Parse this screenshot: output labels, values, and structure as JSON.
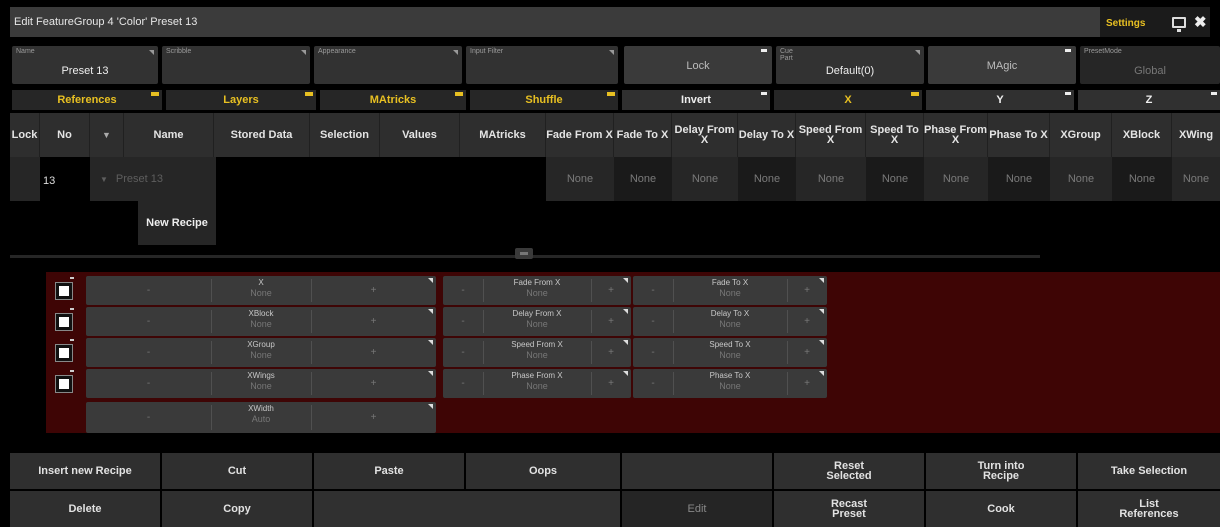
{
  "window": {
    "title": "Edit FeatureGroup 4 'Color' Preset 13",
    "settings_label": "Settings"
  },
  "fields": [
    {
      "label": "Name",
      "value": "Preset 13"
    },
    {
      "label": "Scribble",
      "value": ""
    },
    {
      "label": "Appearance",
      "value": ""
    },
    {
      "label": "Input Filter",
      "value": ""
    },
    {
      "label": "Cue Part",
      "value": "Default(0)"
    },
    {
      "label": "PresetMode",
      "value": "Global"
    }
  ],
  "buttons_top": {
    "lock": "Lock",
    "magic": "MAgic"
  },
  "tabs": [
    "References",
    "Layers",
    "MAtricks",
    "Shuffle",
    "Invert",
    "X",
    "Y",
    "Z"
  ],
  "columns": [
    "Lock",
    "No",
    "",
    "Name",
    "Stored Data",
    "Selection",
    "Values",
    "MAtricks",
    "Fade From X",
    "Fade To X",
    "Delay From X",
    "Delay To X",
    "Speed From X",
    "Speed To X",
    "Phase From X",
    "Phase To X",
    "XGroup",
    "XBlock",
    "XWing"
  ],
  "row": {
    "no": "13",
    "name": "Preset 13",
    "dyn": [
      "None",
      "None",
      "None",
      "None",
      "None",
      "None",
      "None",
      "None",
      "None",
      "None",
      "None"
    ]
  },
  "new_recipe": "New Recipe",
  "editor": {
    "left": [
      {
        "name": "X",
        "value": "None"
      },
      {
        "name": "XBlock",
        "value": "None"
      },
      {
        "name": "XGroup",
        "value": "None"
      },
      {
        "name": "XWings",
        "value": "None"
      },
      {
        "name": "XWidth",
        "value": "Auto"
      }
    ],
    "mid": [
      {
        "name": "Fade From X",
        "value": "None"
      },
      {
        "name": "Delay From X",
        "value": "None"
      },
      {
        "name": "Speed From X",
        "value": "None"
      },
      {
        "name": "Phase From X",
        "value": "None"
      }
    ],
    "right": [
      {
        "name": "Fade To X",
        "value": "None"
      },
      {
        "name": "Delay To X",
        "value": "None"
      },
      {
        "name": "Speed To X",
        "value": "None"
      },
      {
        "name": "Phase To X",
        "value": "None"
      }
    ],
    "minus": "-",
    "plus": "+"
  },
  "bottom": {
    "row1": [
      "Insert new Recipe",
      "Cut",
      "Paste",
      "Oops",
      "",
      "Reset Selected",
      "Turn into Recipe",
      "Take Selection"
    ],
    "row2": [
      "Delete",
      "Copy",
      "",
      "",
      "Edit",
      "Recast Preset",
      "Cook",
      "List References"
    ]
  },
  "colors": {
    "accent": "#e8c022",
    "editor_bg": "#3e0505"
  }
}
